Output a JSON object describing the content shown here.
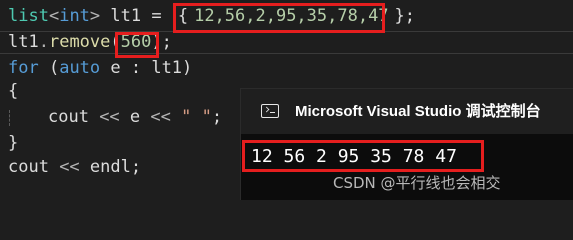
{
  "editor": {
    "line1": {
      "type_list": "list",
      "lt": "<",
      "type_int": "int",
      "gt": ">",
      "var": " lt1 = ",
      "brace_open": "{",
      "values": "12,56,2,95,35,78,47",
      "brace_close": "};"
    },
    "line2": {
      "obj": "lt1",
      "dot": ".",
      "method": "remove",
      "paren_open": "(",
      "arg": "560",
      "paren_close": ");"
    },
    "line3": {
      "kw_for": "for",
      "paren_open": " (",
      "kw_auto": "auto",
      "rest": " e : lt1)"
    },
    "line4": {
      "brace": "{"
    },
    "line5": {
      "cout": "cout",
      "op1": " << ",
      "e": "e",
      "op2": " << ",
      "str": "\" \"",
      "semi": ";"
    },
    "line6": {
      "brace": "}"
    },
    "line7": {
      "cout": "cout",
      "op": " << ",
      "endl": "endl",
      "semi": ";"
    }
  },
  "console": {
    "title": "Microsoft Visual Studio 调试控制台",
    "output": "12 56 2 95 35 78 47",
    "icon": "console-app-icon"
  },
  "watermark": "CSDN @平行线也会相交",
  "colors": {
    "highlight_box": "#e51e1e",
    "editor_bg": "#1e1e1e",
    "console_bg": "#0c0c0c"
  }
}
